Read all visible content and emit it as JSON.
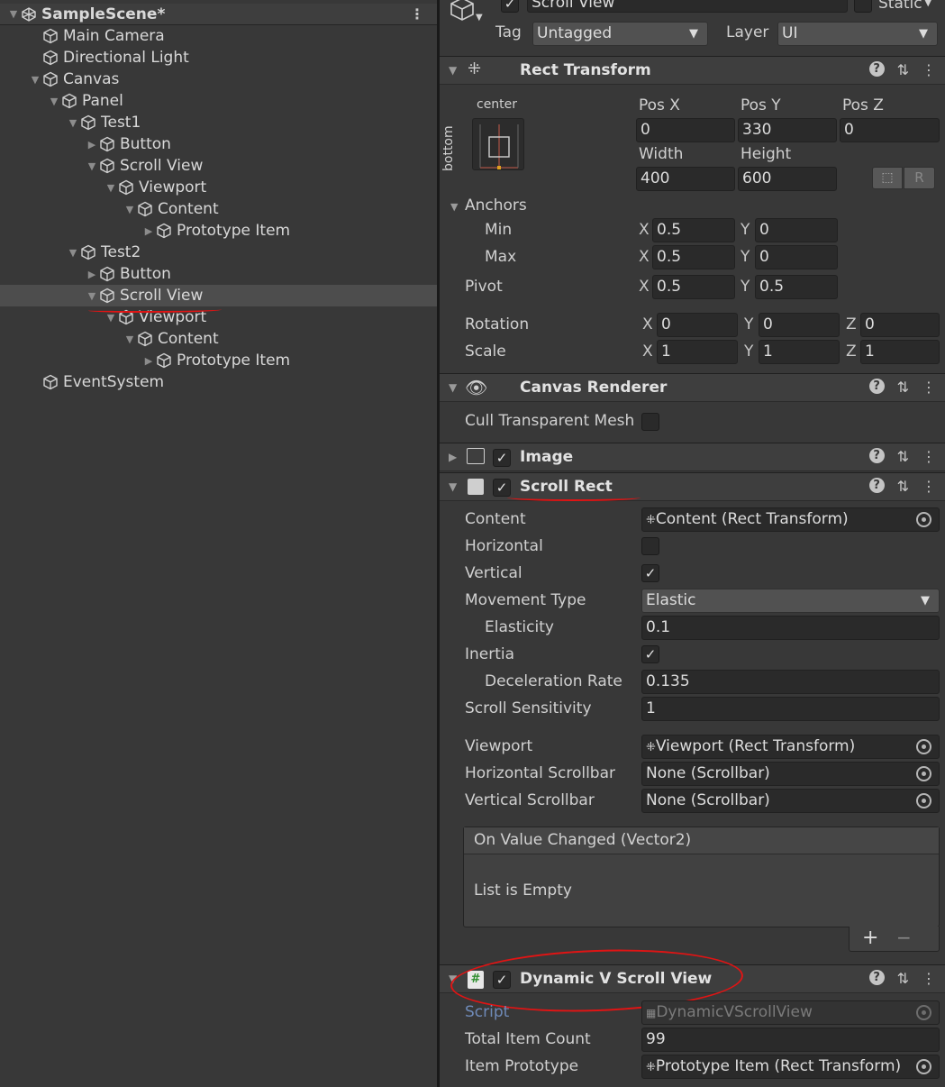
{
  "hierarchy": {
    "scene_name": "SampleScene*",
    "items": [
      {
        "label": "Main Camera"
      },
      {
        "label": "Directional Light"
      },
      {
        "label": "Canvas"
      },
      {
        "label": "Panel"
      },
      {
        "label": "Test1"
      },
      {
        "label": "Button"
      },
      {
        "label": "Scroll View"
      },
      {
        "label": "Viewport"
      },
      {
        "label": "Content"
      },
      {
        "label": "Prototype Item"
      },
      {
        "label": "Test2"
      },
      {
        "label": "Button"
      },
      {
        "label": "Scroll View"
      },
      {
        "label": "Viewport"
      },
      {
        "label": "Content"
      },
      {
        "label": "Prototype Item"
      },
      {
        "label": "EventSystem"
      }
    ],
    "selected_index": 12
  },
  "inspector": {
    "object_name": "Scroll View",
    "static_label": "Static",
    "tag_label": "Tag",
    "tag_value": "Untagged",
    "layer_label": "Layer",
    "layer_value": "UI",
    "rect_transform": {
      "title": "Rect Transform",
      "anchor_h": "center",
      "anchor_v": "bottom",
      "pos_x_label": "Pos X",
      "pos_x": "0",
      "pos_y_label": "Pos Y",
      "pos_y": "330",
      "pos_z_label": "Pos Z",
      "pos_z": "0",
      "width_label": "Width",
      "width": "400",
      "height_label": "Height",
      "height": "600",
      "raw_button": "R",
      "anchors_label": "Anchors",
      "min_label": "Min",
      "min_x": "0.5",
      "min_y": "0",
      "max_label": "Max",
      "max_x": "0.5",
      "max_y": "0",
      "pivot_label": "Pivot",
      "pivot_x": "0.5",
      "pivot_y": "0.5",
      "rotation_label": "Rotation",
      "rot_x": "0",
      "rot_y": "0",
      "rot_z": "0",
      "scale_label": "Scale",
      "scale_x": "1",
      "scale_y": "1",
      "scale_z": "1",
      "x": "X",
      "y": "Y",
      "z": "Z"
    },
    "canvas_renderer": {
      "title": "Canvas Renderer",
      "cull_label": "Cull Transparent Mesh"
    },
    "image": {
      "title": "Image"
    },
    "scroll_rect": {
      "title": "Scroll Rect",
      "content_label": "Content",
      "content_value": "Content (Rect Transform)",
      "horizontal_label": "Horizontal",
      "vertical_label": "Vertical",
      "movement_label": "Movement Type",
      "movement_value": "Elastic",
      "elasticity_label": "Elasticity",
      "elasticity_value": "0.1",
      "inertia_label": "Inertia",
      "decel_label": "Deceleration Rate",
      "decel_value": "0.135",
      "sensitivity_label": "Scroll Sensitivity",
      "sensitivity_value": "1",
      "viewport_label": "Viewport",
      "viewport_value": "Viewport (Rect Transform)",
      "hscroll_label": "Horizontal Scrollbar",
      "hscroll_value": "None (Scrollbar)",
      "vscroll_label": "Vertical Scrollbar",
      "vscroll_value": "None (Scrollbar)",
      "event_title": "On Value Changed (Vector2)",
      "event_empty": "List is Empty",
      "add": "+",
      "remove": "−"
    },
    "dynamic": {
      "title": "Dynamic V Scroll View",
      "script_label": "Script",
      "script_value": "DynamicVScrollView",
      "count_label": "Total Item Count",
      "count_value": "99",
      "proto_label": "Item Prototype",
      "proto_value": "Prototype Item (Rect Transform)"
    }
  },
  "colors": {
    "annotation": "#e01414",
    "background": "#383838"
  }
}
